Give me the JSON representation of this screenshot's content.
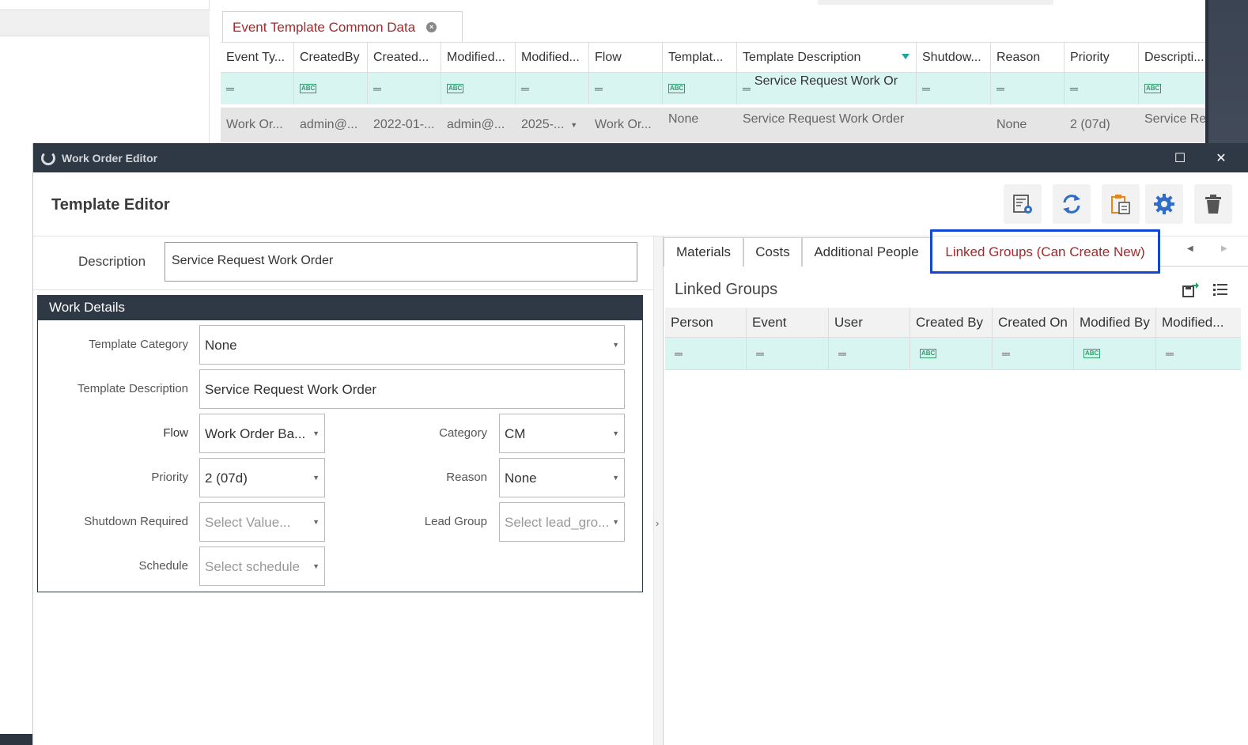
{
  "background": {
    "tab": {
      "label": "Event Template Common Data"
    },
    "grid": {
      "headers": [
        "Event Ty...",
        "CreatedBy",
        "Created...",
        "Modified...",
        "Modified...",
        "Flow",
        "Templat...",
        "Template Description",
        "Shutdow...",
        "Reason",
        "Priority",
        "Descripti..."
      ],
      "filter_text": "Service Request Work Or",
      "row": [
        "Work Or...",
        "admin@...",
        "2022-01-...",
        "admin@...",
        "2025-...",
        "Work Or...",
        "None",
        "Service Request Work Order",
        "",
        "None",
        "2 (07d)",
        "Service Re"
      ]
    }
  },
  "window": {
    "title": "Work Order Editor",
    "maximize": "☐",
    "close": "✕"
  },
  "editor": {
    "title": "Template Editor",
    "toolbar": [
      "template-settings-icon",
      "refresh-icon",
      "clipboard-icon",
      "gear-icon",
      "trash-icon"
    ],
    "description": {
      "label": "Description",
      "value": "Service Request Work Order"
    },
    "work_details": {
      "heading": "Work Details",
      "template_category": {
        "label": "Template Category",
        "value": "None"
      },
      "template_description": {
        "label": "Template Description",
        "value": "Service Request Work Order"
      },
      "flow": {
        "label": "Flow",
        "value": "Work Order Ba..."
      },
      "category": {
        "label": "Category",
        "value": "CM"
      },
      "priority": {
        "label": "Priority",
        "value": "2 (07d)"
      },
      "reason": {
        "label": "Reason",
        "value": "None"
      },
      "shutdown_required": {
        "label": "Shutdown Required",
        "placeholder": "Select Value..."
      },
      "lead_group": {
        "label": "Lead Group",
        "placeholder": "Select lead_gro..."
      },
      "schedule": {
        "label": "Schedule",
        "placeholder": "Select schedule"
      }
    }
  },
  "right": {
    "tabs": [
      "Materials",
      "Costs",
      "Additional People",
      "Linked Groups (Can Create New)"
    ],
    "active_tab": "Linked Groups (Can Create New)",
    "linked_groups": {
      "title": "Linked Groups",
      "headers": [
        "Person",
        "Event",
        "User",
        "Created By",
        "Created On",
        "Modified By",
        "Modified..."
      ]
    }
  },
  "colors": {
    "accent_red": "#a5282b",
    "titlebar": "#2f3845",
    "highlight_blue": "#1446d4",
    "filter_row": "#d9f5f2",
    "icon_blue": "#2f6dc6"
  }
}
